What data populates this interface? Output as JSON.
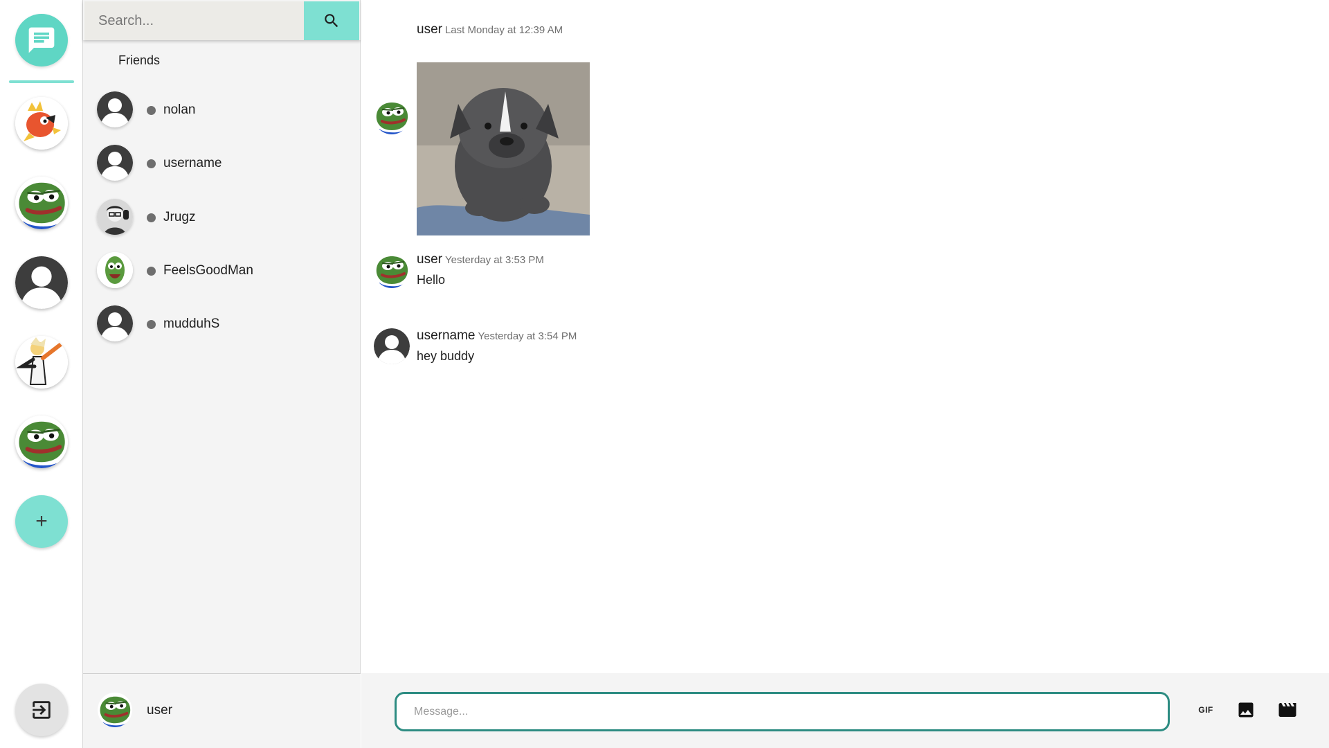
{
  "colors": {
    "accent": "#7ee0d2",
    "accent_dark": "#2d8c82",
    "home": "#5fd6c4",
    "status_offline": "#6e6e6e"
  },
  "rail": {
    "home_icon": "chat-bubble-icon",
    "servers": [
      "magikarp-server",
      "pepe-server",
      "default-avatar-server",
      "dab-server",
      "pepe-server-2"
    ],
    "add_label": "+",
    "logout_icon": "logout-icon"
  },
  "search": {
    "placeholder": "Search...",
    "value": "",
    "icon": "search-icon"
  },
  "friends": {
    "heading": "Friends",
    "items": [
      {
        "name": "nolan",
        "avatar": "default-avatar",
        "status": "offline"
      },
      {
        "name": "username",
        "avatar": "default-avatar",
        "status": "offline"
      },
      {
        "name": "Jrugz",
        "avatar": "photo-avatar",
        "status": "offline"
      },
      {
        "name": "FeelsGoodMan",
        "avatar": "pepe-avatar",
        "status": "offline"
      },
      {
        "name": "mudduhS",
        "avatar": "default-avatar",
        "status": "offline"
      }
    ]
  },
  "current_user": {
    "name": "user",
    "avatar": "pepe-avatar"
  },
  "messages": [
    {
      "author": "user",
      "time": "Last Monday at 12:39 AM",
      "image": "puppy-gif",
      "text": ""
    },
    {
      "author": "user",
      "time": "Yesterday at 3:53 PM",
      "text": "Hello"
    },
    {
      "author": "username",
      "time": "Yesterday at 3:54 PM",
      "text": "hey buddy"
    }
  ],
  "composer": {
    "placeholder": "Message...",
    "value": "",
    "gif_label": "GIF",
    "image_icon": "image-icon",
    "video_icon": "movie-icon"
  }
}
